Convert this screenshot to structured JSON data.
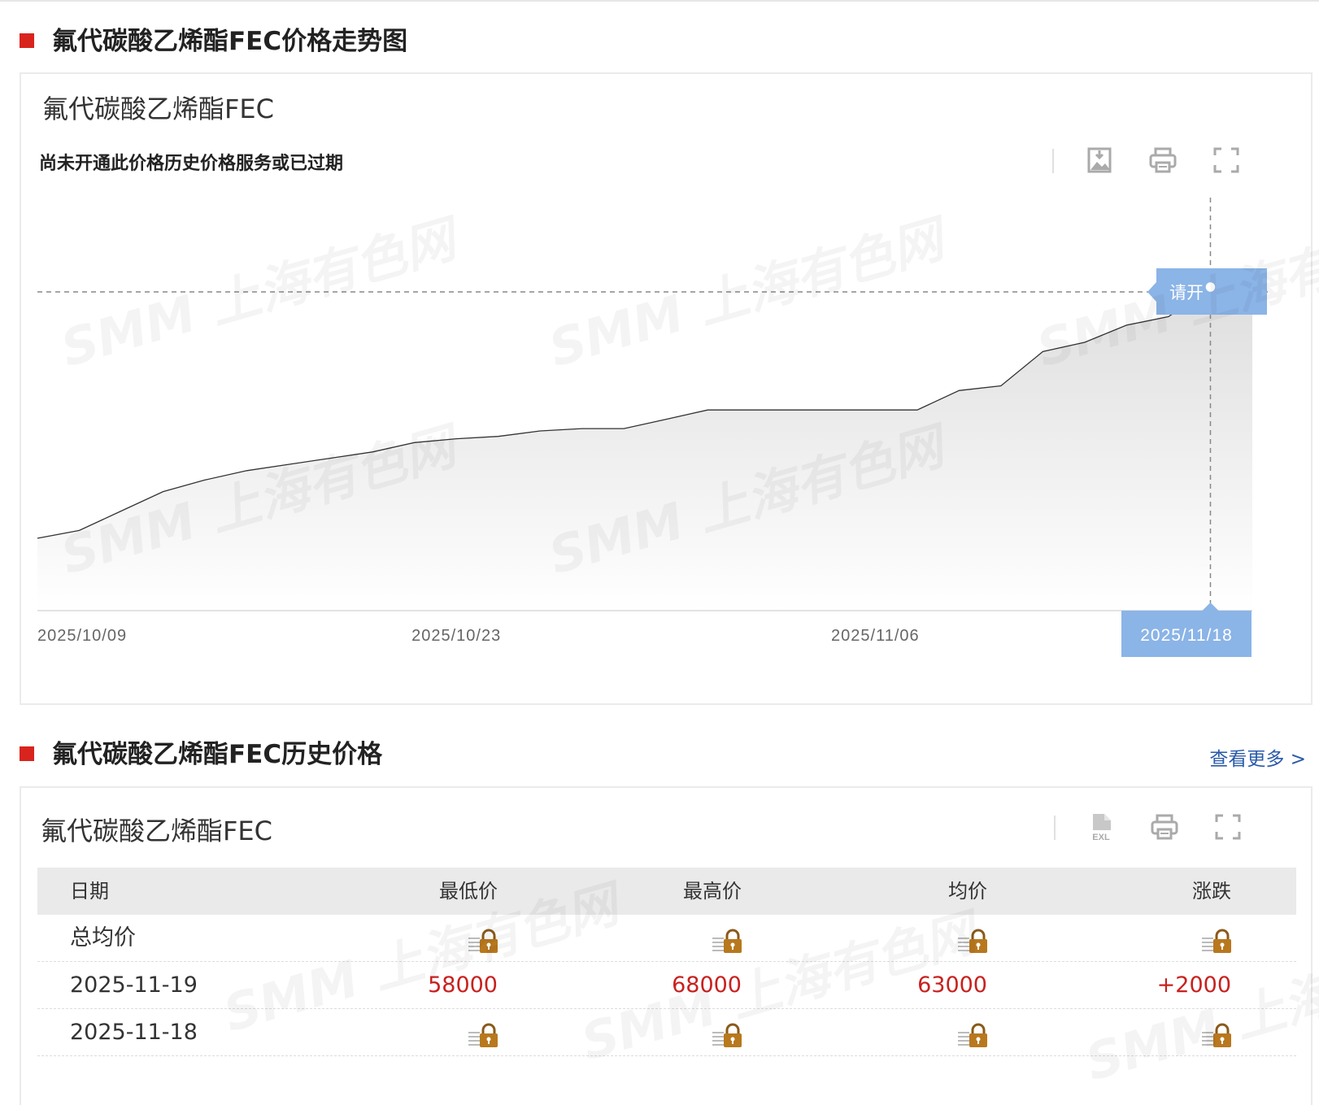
{
  "colors": {
    "accent_red": "#d9231d",
    "tooltip_blue": "#8bb4e7",
    "price_red": "#c8211e",
    "link_blue": "#2a5aa8",
    "line": "#333333"
  },
  "chart_section": {
    "heading": "氟代碳酸乙烯酯FEC价格走势图",
    "panel_title": "氟代碳酸乙烯酯FEC",
    "notice": "尚未开通此价格历史价格服务或已过期",
    "toolbar": [
      "download-image-icon",
      "print-icon",
      "fullscreen-icon"
    ],
    "watermark": "SMM 上海有色网",
    "tooltip_text": "请开",
    "tooltip_date": "2025/11/18"
  },
  "chart_data": {
    "type": "area",
    "title": "氟代碳酸乙烯酯FEC",
    "x_tick_labels": [
      "2025/10/09",
      "2025/10/23",
      "2025/11/06"
    ],
    "xlabel": "",
    "ylabel": "",
    "y_axis_labels_shown": false,
    "grid": false,
    "series": [
      {
        "x": [
          "2025/10/09",
          "2025/10/10",
          "2025/10/13",
          "2025/10/14",
          "2025/10/15",
          "2025/10/16",
          "2025/10/17",
          "2025/10/20",
          "2025/10/21",
          "2025/10/22",
          "2025/10/23",
          "2025/10/24",
          "2025/10/27",
          "2025/10/28",
          "2025/10/29",
          "2025/10/30",
          "2025/10/31",
          "2025/11/03",
          "2025/11/04",
          "2025/11/05",
          "2025/11/06",
          "2025/11/07",
          "2025/11/10",
          "2025/11/11",
          "2025/11/12",
          "2025/11/13",
          "2025/11/14",
          "2025/11/17",
          "2025/11/18",
          "2025/11/19"
        ],
        "values": [
          26.5,
          27.5,
          30,
          32.5,
          34,
          35.2,
          36,
          36.8,
          37.6,
          38.8,
          39.3,
          39.6,
          40.3,
          40.6,
          40.6,
          41.8,
          43,
          43,
          43,
          43,
          43,
          43,
          45.5,
          46.1,
          50.5,
          51.7,
          53.9,
          55,
          58.8,
          61
        ]
      }
    ],
    "highlight": {
      "x": "2025/11/18",
      "label": "2025/11/18"
    }
  },
  "history_section": {
    "heading": "氟代碳酸乙烯酯FEC历史价格",
    "more_link": "查看更多 >",
    "panel_title": "氟代碳酸乙烯酯FEC",
    "toolbar": [
      "excel-export-icon",
      "print-icon",
      "fullscreen-icon"
    ],
    "columns": [
      "日期",
      "最低价",
      "最高价",
      "均价",
      "涨跌"
    ],
    "rows": [
      {
        "date": "总均价",
        "locked": true
      },
      {
        "date": "2025-11-19",
        "locked": false,
        "low": "58000",
        "high": "68000",
        "avg": "63000",
        "change": "+2000"
      },
      {
        "date": "2025-11-18",
        "locked": true
      }
    ]
  }
}
